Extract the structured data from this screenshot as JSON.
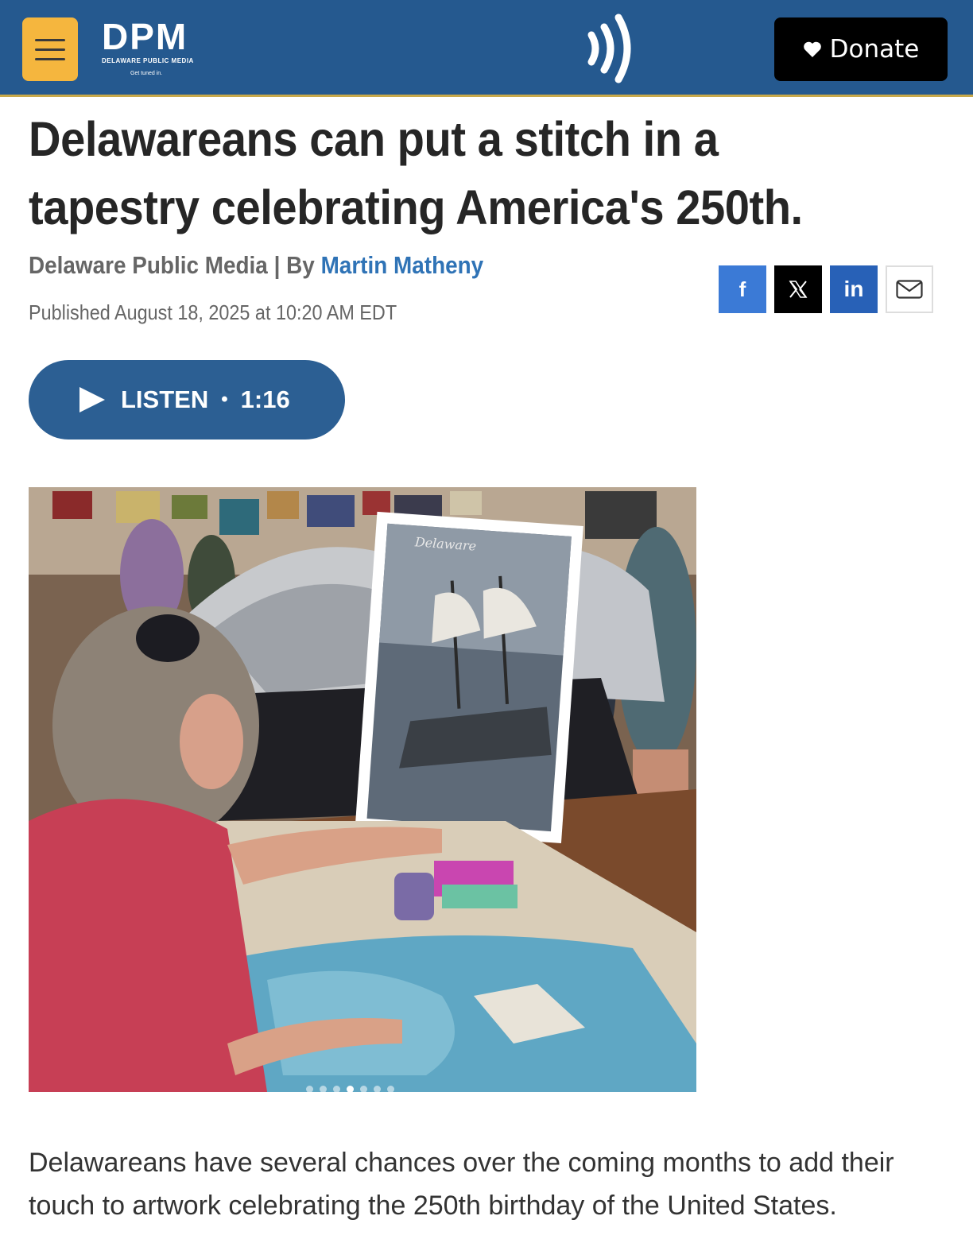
{
  "header": {
    "logo_text": "DPM",
    "logo_subtitle": "DELAWARE PUBLIC MEDIA",
    "logo_tagline": "Get tuned in.",
    "donate_label": "Donate",
    "colors": {
      "bar": "#25598f",
      "menu": "#f5b63e",
      "donate": "#000000"
    },
    "icons": [
      "hamburger-icon",
      "radio-waves-icon",
      "heart-icon"
    ]
  },
  "article": {
    "headline": "Delawareans can put a stitch in a tapestry celebrating America's 250th.",
    "source": "Delaware Public Media",
    "by_prefix": "| By",
    "author": "Martin Matheny",
    "published": "Published August 18, 2025 at 10:20 AM EDT",
    "share": {
      "facebook": "f",
      "linkedin": "in"
    },
    "listen": {
      "label": "LISTEN",
      "separator": "•",
      "duration": "1:16"
    },
    "photo": {
      "tapestry_caption_text": "Delaware",
      "slide_count": 7,
      "active_slide": 4
    },
    "lead": "Delawareans have several chances over the coming months to add their touch to artwork celebrating the 250th birthday of the United States."
  }
}
